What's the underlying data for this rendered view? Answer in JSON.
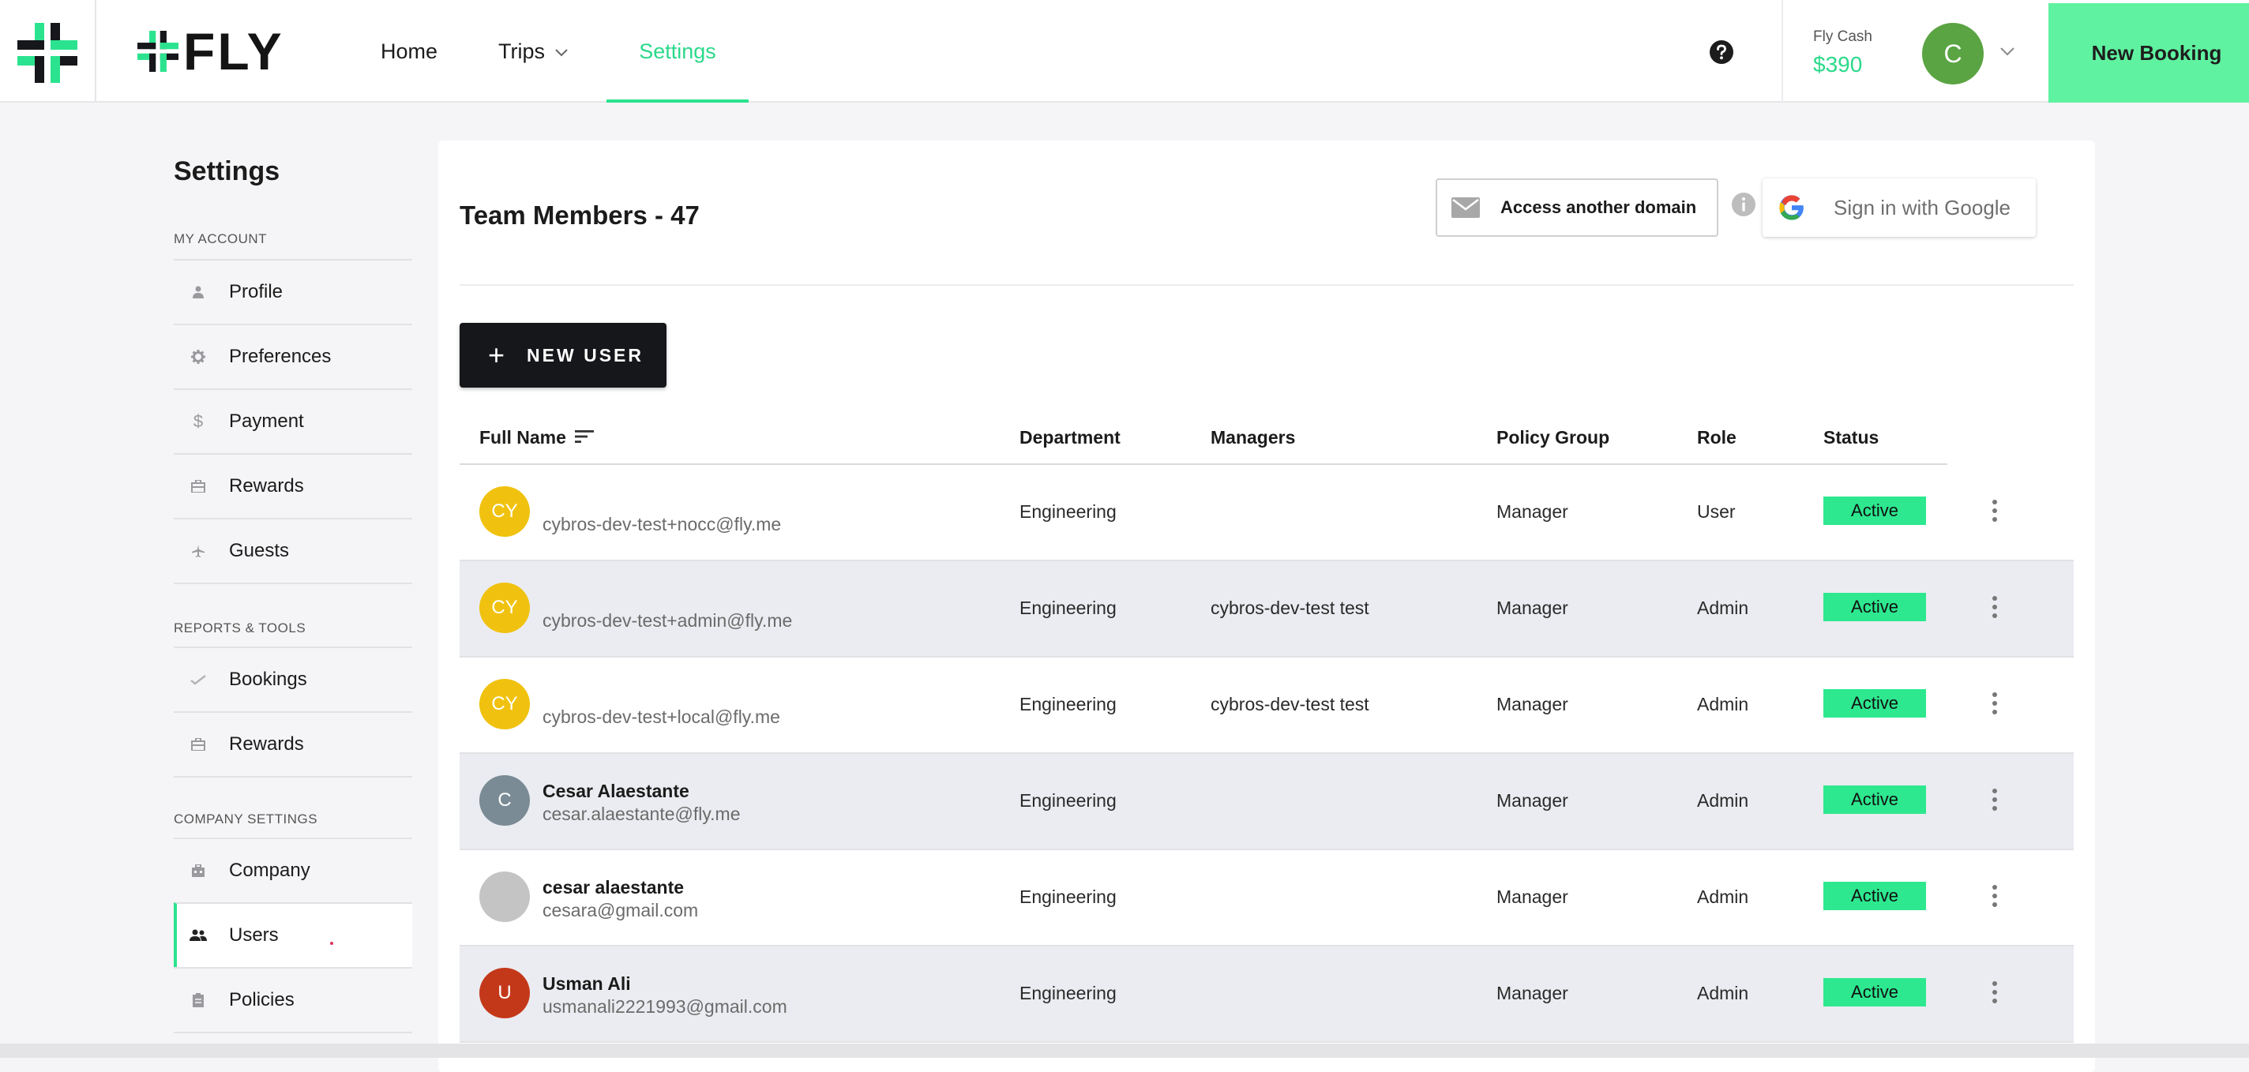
{
  "brand": {
    "name": "FLY"
  },
  "nav": {
    "home": "Home",
    "trips": "Trips",
    "settings": "Settings"
  },
  "header": {
    "fly_cash_label": "Fly Cash",
    "fly_cash_value": "$390",
    "avatar_initial": "C",
    "new_booking": "New Booking"
  },
  "sidebar": {
    "title": "Settings",
    "sections": {
      "my_account": "MY ACCOUNT",
      "reports_tools": "REPORTS & TOOLS",
      "company_settings": "COMPANY SETTINGS"
    },
    "items": {
      "profile": "Profile",
      "preferences": "Preferences",
      "payment": "Payment",
      "rewards": "Rewards",
      "guests": "Guests",
      "bookings": "Bookings",
      "reports_rewards": "Rewards",
      "company": "Company",
      "users": "Users",
      "policies": "Policies"
    }
  },
  "main": {
    "title": "Team Members - 47",
    "access_domain": "Access another domain",
    "google_sign_in": "Sign in with Google",
    "new_user": "NEW USER",
    "columns": {
      "full_name": "Full Name",
      "department": "Department",
      "managers": "Managers",
      "policy_group": "Policy Group",
      "role": "Role",
      "status": "Status"
    },
    "rows": [
      {
        "initials": "CY",
        "avatar_color": "#f0c20f",
        "name": "",
        "email": "cybros-dev-test+nocc@fly.me",
        "department": "Engineering",
        "managers": "",
        "policy_group": "Manager",
        "role": "User",
        "status": "Active"
      },
      {
        "initials": "CY",
        "avatar_color": "#f0c20f",
        "name": "",
        "email": "cybros-dev-test+admin@fly.me",
        "department": "Engineering",
        "managers": "cybros-dev-test test",
        "policy_group": "Manager",
        "role": "Admin",
        "status": "Active"
      },
      {
        "initials": "CY",
        "avatar_color": "#f0c20f",
        "name": "",
        "email": "cybros-dev-test+local@fly.me",
        "department": "Engineering",
        "managers": "cybros-dev-test test",
        "policy_group": "Manager",
        "role": "Admin",
        "status": "Active"
      },
      {
        "initials": "C",
        "avatar_color": "#7a8b95",
        "name": "Cesar Alaestante",
        "email": "cesar.alaestante@fly.me",
        "department": "Engineering",
        "managers": "",
        "policy_group": "Manager",
        "role": "Admin",
        "status": "Active"
      },
      {
        "initials": "",
        "avatar_color": "#c4c4c4",
        "name": "cesar alaestante",
        "email": "cesara@gmail.com",
        "department": "Engineering",
        "managers": "",
        "policy_group": "Manager",
        "role": "Admin",
        "status": "Active"
      },
      {
        "initials": "U",
        "avatar_color": "#c4381a",
        "name": "Usman Ali",
        "email": "usmanali2221993@gmail.com",
        "department": "Engineering",
        "managers": "",
        "policy_group": "Manager",
        "role": "Admin",
        "status": "Active"
      }
    ]
  }
}
